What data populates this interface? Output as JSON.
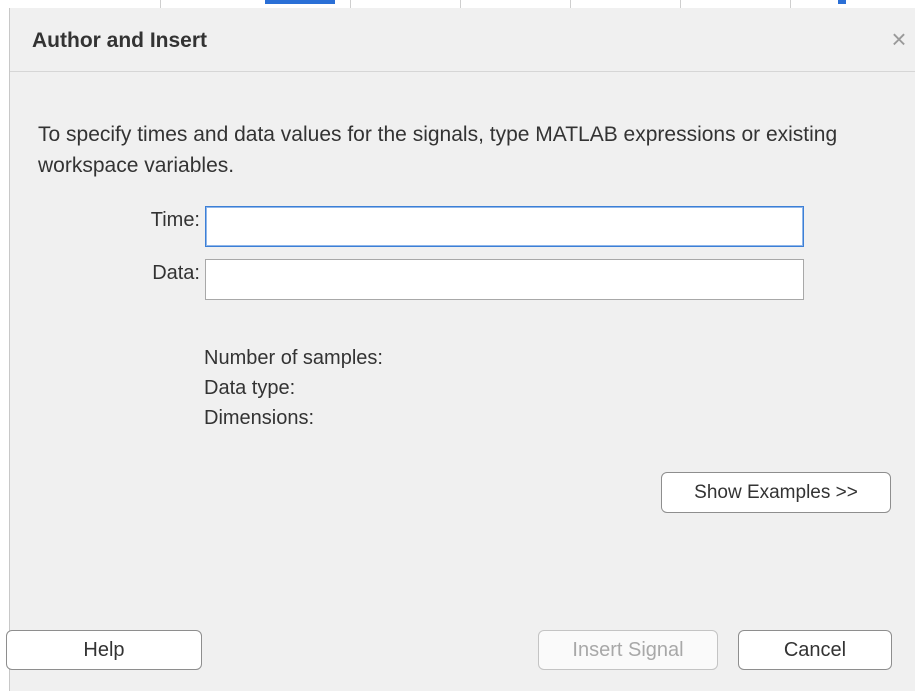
{
  "dialog": {
    "title": "Author and Insert",
    "close_symbol": "×",
    "instructions": "To specify times and data values for the signals, type MATLAB expressions or existing workspace variables."
  },
  "fields": {
    "time": {
      "label": "Time:",
      "value": "",
      "placeholder": ""
    },
    "data": {
      "label": "Data:",
      "value": "",
      "placeholder": ""
    }
  },
  "info": {
    "num_samples_label": "Number of samples:",
    "data_type_label": "Data type:",
    "dimensions_label": "Dimensions:"
  },
  "buttons": {
    "show_examples": "Show Examples >>",
    "help": "Help",
    "insert_signal": "Insert Signal",
    "cancel": "Cancel"
  },
  "icons": {
    "close": "close-icon"
  },
  "colors": {
    "dialog_bg": "#f0f0f0",
    "focus_border": "#3c7fd6",
    "disabled_text": "#a8a8a8"
  }
}
